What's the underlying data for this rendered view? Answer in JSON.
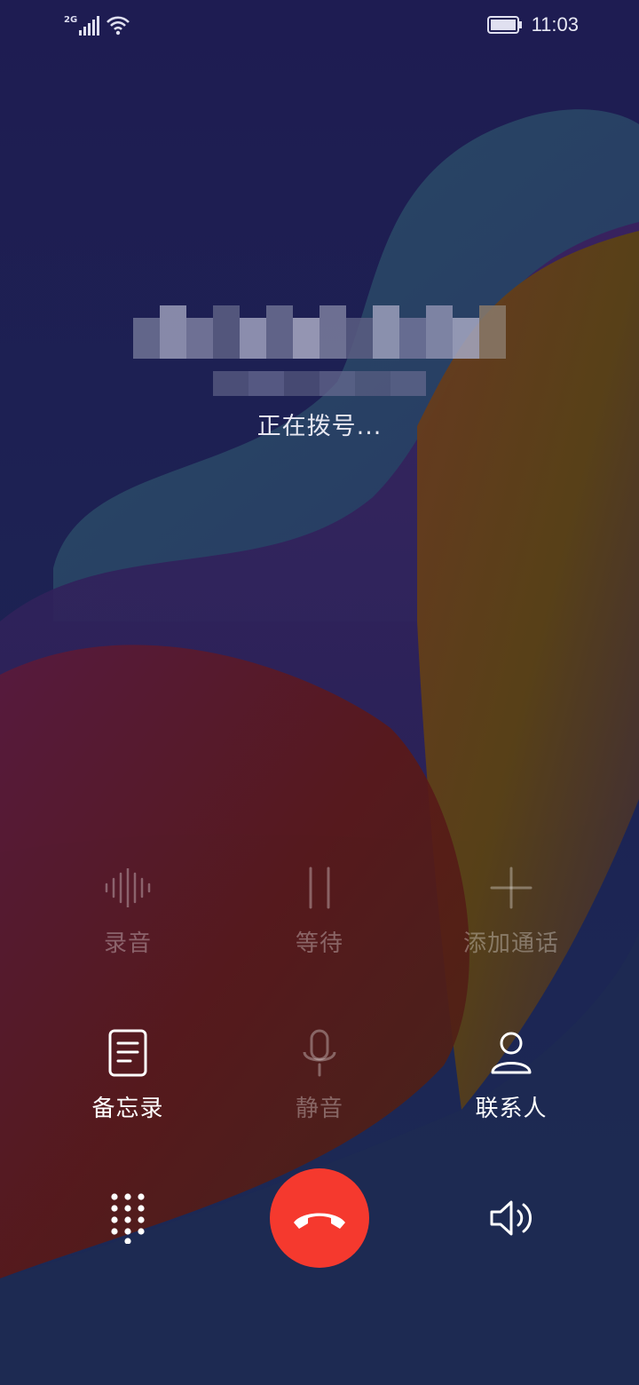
{
  "status_bar": {
    "network_label": "2G",
    "time": "11:03",
    "signal_icon": "signal-bars-icon",
    "wifi_icon": "wifi-icon",
    "battery_icon": "battery-icon"
  },
  "call": {
    "status": "正在拨号..."
  },
  "actions_row1": [
    {
      "label": "录音",
      "icon": "waveform-icon",
      "enabled": false
    },
    {
      "label": "等待",
      "icon": "pause-icon",
      "enabled": false
    },
    {
      "label": "添加通话",
      "icon": "plus-icon",
      "enabled": false
    }
  ],
  "actions_row2": [
    {
      "label": "备忘录",
      "icon": "memo-icon",
      "enabled": true
    },
    {
      "label": "静音",
      "icon": "microphone-icon",
      "enabled": false
    },
    {
      "label": "联系人",
      "icon": "contact-person-icon",
      "enabled": true
    }
  ],
  "bottom": {
    "dialpad_icon": "dialpad-icon",
    "end_call_icon": "end-call-icon",
    "speaker_icon": "speaker-icon",
    "end_call_color": "#f5392e"
  }
}
